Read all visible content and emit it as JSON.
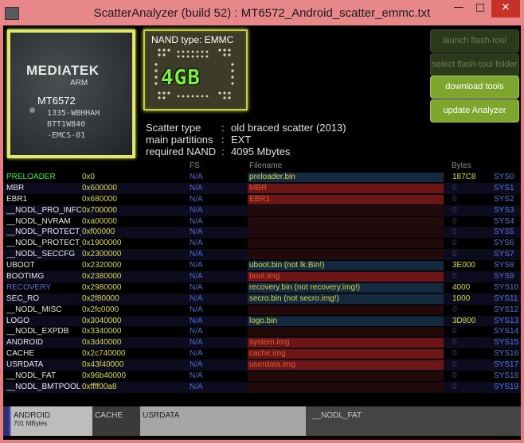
{
  "window": {
    "title": "ScatterAnalyzer (build 52) : MT6572_Android_scatter_emmc.txt",
    "minimize": "—",
    "maximize": "□",
    "close": "✕"
  },
  "chip": {
    "brand": "MEDIATEK",
    "brand_sub": "ARM",
    "model": "MT6572",
    "line1": "1335-WBHHAH",
    "line2": "BTT1W840",
    "line3": "-EMCS-01"
  },
  "nand": {
    "label": "NAND type: EMMC",
    "size": "4GB"
  },
  "info": {
    "scatter_type_label": "Scatter type",
    "scatter_type_value": "old braced scatter (2013)",
    "main_partitions_label": "main partitions",
    "main_partitions_value": "EXT",
    "required_nand_label": "required NAND",
    "required_nand_value": "4095 Mbytes",
    "sep": ":"
  },
  "buttons": {
    "launch": "launch flash-tool",
    "select": "select flash-tool folder",
    "download": "download tools",
    "update": "update Analyzer"
  },
  "table": {
    "headers": {
      "fs": "FS",
      "filename": "Filename",
      "bytes": "Bytes"
    },
    "rows": [
      {
        "name": "PRELOADER",
        "addr": "0x0",
        "fs": "N/A",
        "file": "preloader.bin",
        "file_state": "ok",
        "bytes": "187C8",
        "sys": "SYS0",
        "name_color": "green"
      },
      {
        "name": "MBR",
        "addr": "0x600000",
        "fs": "N/A",
        "file": "MBR",
        "file_state": "bad",
        "bytes": "0",
        "sys": "SYS1"
      },
      {
        "name": "EBR1",
        "addr": "0x680000",
        "fs": "N/A",
        "file": "EBR1",
        "file_state": "bad",
        "bytes": "0",
        "sys": "SYS2"
      },
      {
        "name": "__NODL_PRO_INFO",
        "addr": "0x700000",
        "fs": "N/A",
        "file": "",
        "file_state": "empty",
        "bytes": "0",
        "sys": "SYS3"
      },
      {
        "name": "__NODL_NVRAM",
        "addr": "0xa00000",
        "fs": "N/A",
        "file": "",
        "file_state": "empty",
        "bytes": "0",
        "sys": "SYS4"
      },
      {
        "name": "__NODL_PROTECT_F",
        "addr": "0xf00000",
        "fs": "N/A",
        "file": "",
        "file_state": "empty",
        "bytes": "0",
        "sys": "SYS5"
      },
      {
        "name": "__NODL_PROTECT_S",
        "addr": "0x1900000",
        "fs": "N/A",
        "file": "",
        "file_state": "empty",
        "bytes": "0",
        "sys": "SYS6"
      },
      {
        "name": "__NODL_SECCFG",
        "addr": "0x2300000",
        "fs": "N/A",
        "file": "",
        "file_state": "empty",
        "bytes": "0",
        "sys": "SYS7"
      },
      {
        "name": "UBOOT",
        "addr": "0x2320000",
        "fs": "N/A",
        "file": "uboot.bin (not lk.Bin!)",
        "file_state": "ok",
        "bytes": "3E000",
        "sys": "SYS8"
      },
      {
        "name": "BOOTIMG",
        "addr": "0x2380000",
        "fs": "N/A",
        "file": "boot.img",
        "file_state": "bad",
        "bytes": "0",
        "sys": "SYS9"
      },
      {
        "name": "RECOVERY",
        "addr": "0x2980000",
        "fs": "N/A",
        "file": "recovery.bin (not recovery.img!)",
        "file_state": "ok",
        "bytes": "4000",
        "sys": "SYS10",
        "name_color": "blue"
      },
      {
        "name": "SEC_RO",
        "addr": "0x2f80000",
        "fs": "N/A",
        "file": "secro.bin (not secro.img!)",
        "file_state": "ok",
        "bytes": "1000",
        "sys": "SYS11"
      },
      {
        "name": "__NODL_MISC",
        "addr": "0x2fc0000",
        "fs": "N/A",
        "file": "",
        "file_state": "empty",
        "bytes": "0",
        "sys": "SYS12"
      },
      {
        "name": "LOGO",
        "addr": "0x3040000",
        "fs": "N/A",
        "file": "logo.bin",
        "file_state": "ok",
        "bytes": "3D800",
        "sys": "SYS13"
      },
      {
        "name": "__NODL_EXPDB",
        "addr": "0x3340000",
        "fs": "N/A",
        "file": "",
        "file_state": "empty",
        "bytes": "0",
        "sys": "SYS14"
      },
      {
        "name": "ANDROID",
        "addr": "0x3d40000",
        "fs": "N/A",
        "file": "system.img",
        "file_state": "bad",
        "bytes": "0",
        "sys": "SYS15"
      },
      {
        "name": "CACHE",
        "addr": "0x2c740000",
        "fs": "N/A",
        "file": "cache.img",
        "file_state": "bad",
        "bytes": "0",
        "sys": "SYS16"
      },
      {
        "name": "USRDATA",
        "addr": "0x43f40000",
        "fs": "N/A",
        "file": "userdata.img",
        "file_state": "bad",
        "bytes": "0",
        "sys": "SYS17"
      },
      {
        "name": "__NODL_FAT",
        "addr": "0x96b40000",
        "fs": "N/A",
        "file": "",
        "file_state": "empty",
        "bytes": "0",
        "sys": "SYS18"
      },
      {
        "name": "__NODL_BMTPOOL",
        "addr": "0xffff00a8",
        "fs": "N/A",
        "file": "",
        "file_state": "empty",
        "bytes": "0",
        "sys": "SYS19"
      }
    ]
  },
  "partition_bar": {
    "android_label": "ANDROID",
    "android_size": "701 MBytes",
    "cache_label": "CACHE",
    "usrdata_label": "USRDATA",
    "fat_label": "__NODL_FAT"
  }
}
